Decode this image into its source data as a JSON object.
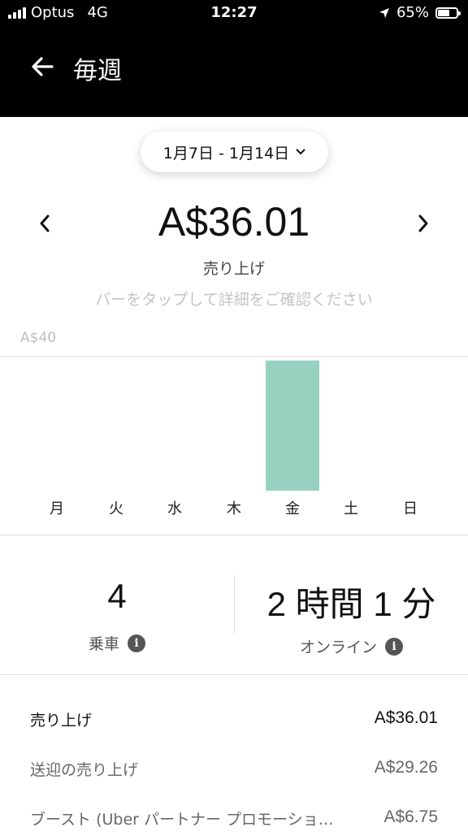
{
  "status_bar": {
    "carrier": "Optus",
    "network": "4G",
    "time": "12:27",
    "battery": "65%",
    "battery_level": 0.65
  },
  "header": {
    "title": "毎週",
    "back_icon": "arrow-left-icon"
  },
  "period": {
    "label": "1月7日 - 1月14日",
    "dropdown_icon": "chevron-down-icon"
  },
  "summary": {
    "amount": "A$36.01",
    "label": "売り上げ",
    "hint": "バーをタップして詳細をご確認ください",
    "prev_icon": "chevron-left-icon",
    "next_icon": "chevron-right-icon"
  },
  "chart_data": {
    "type": "bar",
    "categories": [
      "月",
      "火",
      "水",
      "木",
      "金",
      "土",
      "日"
    ],
    "values": [
      0,
      0,
      0,
      0,
      36.01,
      0,
      0
    ],
    "ylim": [
      0,
      40
    ],
    "y_max_label": "A$40",
    "bar_color": "#96d2bf",
    "grid": false
  },
  "stats": [
    {
      "value": "4",
      "label": "乗車",
      "icon": "info-icon"
    },
    {
      "value": "2 時間 1 分",
      "label": "オンライン",
      "icon": "info-icon"
    }
  ],
  "breakdown": [
    {
      "label": "売り上げ",
      "value": "A$36.01"
    },
    {
      "label": "送迎の売り上げ",
      "value": "A$29.26"
    },
    {
      "label": "ブースト (Uber パートナー プロモーショ…",
      "value": "A$6.75"
    }
  ]
}
